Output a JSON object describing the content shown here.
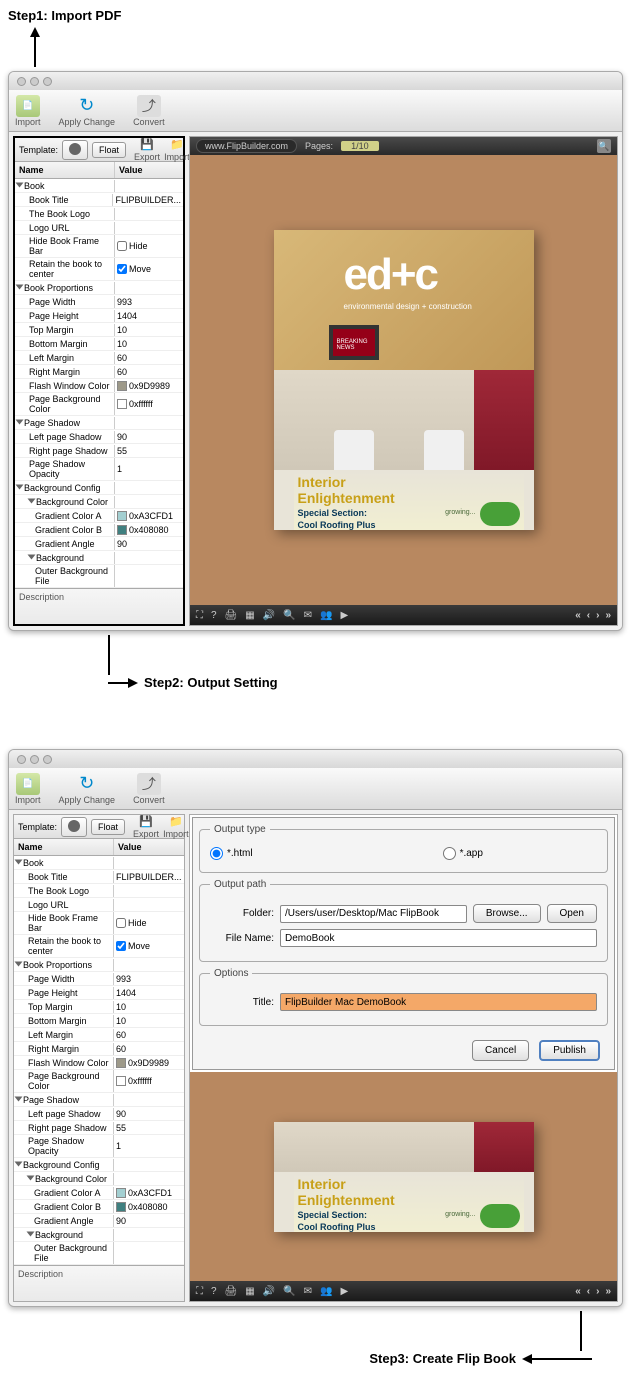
{
  "step1_label": "Step1: Import PDF",
  "step2_label": "Step2: Output Setting",
  "step3_label": "Step3: Create Flip Book",
  "toolbar": {
    "import": "Import",
    "apply_change": "Apply Change",
    "convert": "Convert"
  },
  "template_bar": {
    "label": "Template:",
    "float_btn": "Float",
    "export_btn": "Export",
    "import_btn": "Import"
  },
  "prop_headers": {
    "name": "Name",
    "value": "Value"
  },
  "props": {
    "book": "Book",
    "book_title": "Book Title",
    "book_title_val": "FLIPBUILDER...",
    "book_logo": "The Book Logo",
    "logo_url": "Logo URL",
    "hide_frame": "Hide Book Frame Bar",
    "hide_val": "Hide",
    "retain_center": "Retain the book to center",
    "move_val": "Move",
    "book_proportions": "Book Proportions",
    "page_width": "Page Width",
    "page_width_val": "993",
    "page_height": "Page Height",
    "page_height_val": "1404",
    "top_margin": "Top Margin",
    "top_margin_val": "10",
    "bottom_margin": "Bottom Margin",
    "bottom_margin_val": "10",
    "left_margin": "Left Margin",
    "left_margin_val": "60",
    "right_margin": "Right Margin",
    "right_margin_val": "60",
    "flash_color": "Flash Window Color",
    "flash_color_val": "0x9D9989",
    "page_bg_color": "Page Background Color",
    "page_bg_color_val": "0xffffff",
    "page_shadow": "Page Shadow",
    "left_shadow": "Left page Shadow",
    "left_shadow_val": "90",
    "right_shadow": "Right page Shadow",
    "right_shadow_val": "55",
    "shadow_opacity": "Page Shadow Opacity",
    "shadow_opacity_val": "1",
    "bg_config": "Background Config",
    "bg_color": "Background Color",
    "grad_a": "Gradient Color A",
    "grad_a_val": "0xA3CFD1",
    "grad_b": "Gradient Color B",
    "grad_b_val": "0x408080",
    "grad_angle": "Gradient Angle",
    "grad_angle_val": "90",
    "background": "Background",
    "outer_bg": "Outer Background File"
  },
  "description_label": "Description",
  "url_bar": {
    "url": "www.FlipBuilder.com",
    "pages_label": "Pages:",
    "pages_val": "1/10"
  },
  "book": {
    "logo": "ed+c",
    "subtitle": "environmental design + construction",
    "breaking": "BREAKING NEWS",
    "title1a": "Interior",
    "title1b": "Enlightenment",
    "title2a": "Special Section:",
    "title2b": "Cool Roofing Plus",
    "growing": "growing..."
  },
  "export": {
    "output_type_legend": "Output type",
    "opt_html": "*.html",
    "opt_app": "*.app",
    "output_path_legend": "Output path",
    "folder_label": "Folder:",
    "folder_val": "/Users/user/Desktop/Mac FlipBook",
    "browse_btn": "Browse...",
    "open_btn": "Open",
    "filename_label": "File Name:",
    "filename_val": "DemoBook",
    "options_legend": "Options",
    "title_label": "Title:",
    "title_val": "FlipBuilder Mac DemoBook",
    "cancel_btn": "Cancel",
    "publish_btn": "Publish"
  }
}
